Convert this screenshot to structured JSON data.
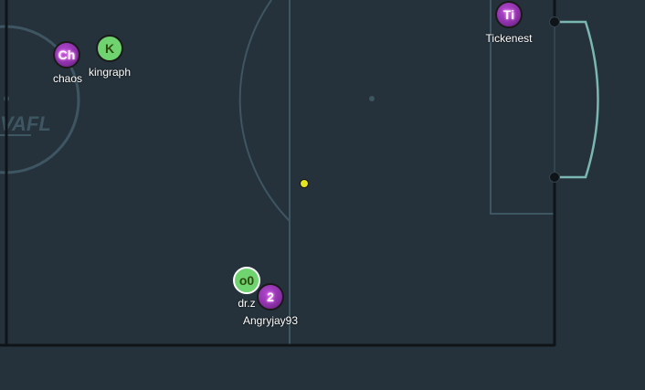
{
  "pitch": {
    "background_color": "#25323b",
    "line_color": "#3e5562",
    "goal_color": "#7ab7b3",
    "boundary_color": "#0e1418",
    "watermark": "VAFL"
  },
  "ball": {
    "color": "#e4e420"
  },
  "players": [
    {
      "id": "chaos",
      "initials": "Ch",
      "name": "chaos",
      "team": "red"
    },
    {
      "id": "kingraph",
      "initials": "K",
      "name": "kingraph",
      "team": "blue"
    },
    {
      "id": "tickenest",
      "initials": "Ti",
      "name": "Tickenest",
      "team": "red"
    },
    {
      "id": "drz",
      "initials": "o0",
      "name": "dr.z",
      "team": "blue",
      "is_self": true
    },
    {
      "id": "angryjay93",
      "initials": "2",
      "name": "Angryjay93",
      "team": "red"
    }
  ]
}
